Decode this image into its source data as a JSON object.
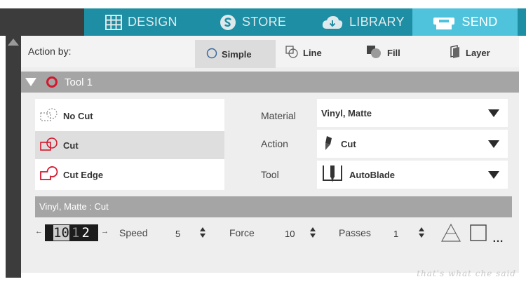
{
  "nav": {
    "tabs": [
      {
        "label": "DESIGN",
        "icon": "grid-icon"
      },
      {
        "label": "STORE",
        "icon": "s-logo-icon"
      },
      {
        "label": "LIBRARY",
        "icon": "cloud-icon"
      },
      {
        "label": "SEND",
        "icon": "plotter-icon",
        "active": true
      }
    ]
  },
  "action_by": {
    "label": "Action by:",
    "options": [
      {
        "label": "Simple",
        "icon": "circle-outline-icon",
        "selected": true
      },
      {
        "label": "Line",
        "icon": "line-icon"
      },
      {
        "label": "Fill",
        "icon": "fill-icon"
      },
      {
        "label": "Layer",
        "icon": "layer-icon"
      }
    ]
  },
  "tool": {
    "name": "Tool 1"
  },
  "cut_options": [
    {
      "label": "No Cut",
      "icon": "no-cut-icon"
    },
    {
      "label": "Cut",
      "icon": "cut-icon",
      "selected": true
    },
    {
      "label": "Cut Edge",
      "icon": "cut-edge-icon"
    }
  ],
  "settings": {
    "material": {
      "label": "Material",
      "value": "Vinyl, Matte"
    },
    "action": {
      "label": "Action",
      "value": "Cut"
    },
    "tool": {
      "label": "Tool",
      "value": "AutoBlade"
    }
  },
  "summary": "Vinyl, Matte : Cut",
  "params": {
    "blade_digits": [
      "10",
      "1",
      "2"
    ],
    "speed": {
      "label": "Speed",
      "value": "5"
    },
    "force": {
      "label": "Force",
      "value": "10"
    },
    "passes": {
      "label": "Passes",
      "value": "1"
    }
  },
  "colors": {
    "teal": "#1d8ea3",
    "send_active": "#4fc3dc",
    "tool_ring": "#d3182e"
  },
  "watermark": "that's what che said"
}
